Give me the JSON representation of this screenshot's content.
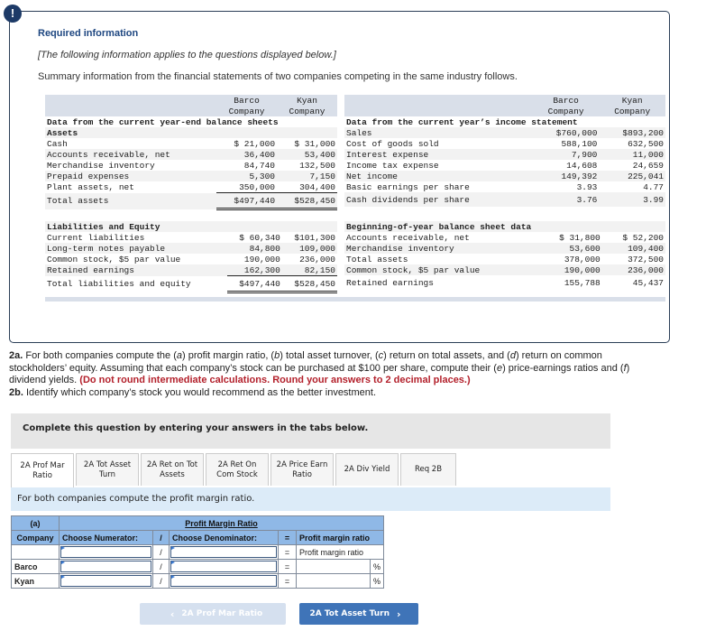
{
  "header": {
    "badge": "!",
    "title": "Required information",
    "italic_note": "[The following information applies to the questions displayed below.]",
    "summary": "Summary information from the financial statements of two companies competing in the same industry follows."
  },
  "columns": {
    "barco": "Barco",
    "barco2": "Company",
    "kyan": "Kyan",
    "kyan2": "Company"
  },
  "balance_sheet": {
    "title": "Data from the current year-end balance sheets",
    "assets_heading": "Assets",
    "rows": [
      {
        "label": "Cash",
        "barco": "$ 21,000",
        "kyan": "$ 31,000"
      },
      {
        "label": "Accounts receivable, net",
        "barco": "36,400",
        "kyan": "53,400"
      },
      {
        "label": "Merchandise inventory",
        "barco": "84,740",
        "kyan": "132,500"
      },
      {
        "label": "Prepaid expenses",
        "barco": "5,300",
        "kyan": "7,150"
      },
      {
        "label": "Plant assets, net",
        "barco": "350,000",
        "kyan": "304,400"
      },
      {
        "label": "Total assets",
        "barco": "$497,440",
        "kyan": "$528,450"
      }
    ],
    "liab_heading": "Liabilities and Equity",
    "liab_rows": [
      {
        "label": "Current liabilities",
        "barco": "$ 60,340",
        "kyan": "$101,300"
      },
      {
        "label": "Long-term notes payable",
        "barco": "84,800",
        "kyan": "109,000"
      },
      {
        "label": "Common stock, $5 par value",
        "barco": "190,000",
        "kyan": "236,000"
      },
      {
        "label": "Retained earnings",
        "barco": "162,300",
        "kyan": "82,150"
      },
      {
        "label": "Total liabilities and equity",
        "barco": "$497,440",
        "kyan": "$528,450"
      }
    ]
  },
  "income_statement": {
    "title": "Data from the current year’s income statement",
    "rows": [
      {
        "label": "Sales",
        "barco": "$760,000",
        "kyan": "$893,200"
      },
      {
        "label": "Cost of goods sold",
        "barco": "588,100",
        "kyan": "632,500"
      },
      {
        "label": "Interest expense",
        "barco": "7,900",
        "kyan": "11,000"
      },
      {
        "label": "Income tax expense",
        "barco": "14,608",
        "kyan": "24,659"
      },
      {
        "label": "Net income",
        "barco": "149,392",
        "kyan": "225,041"
      },
      {
        "label": "Basic earnings per share",
        "barco": "3.93",
        "kyan": "4.77"
      },
      {
        "label": "Cash dividends per share",
        "barco": "3.76",
        "kyan": "3.99"
      }
    ]
  },
  "beginning": {
    "title": "Beginning-of-year balance sheet data",
    "rows": [
      {
        "label": "Accounts receivable, net",
        "barco": "$ 31,800",
        "kyan": "$ 52,200"
      },
      {
        "label": "Merchandise inventory",
        "barco": "53,600",
        "kyan": "109,400"
      },
      {
        "label": "Total assets",
        "barco": "378,000",
        "kyan": "372,500"
      },
      {
        "label": "Common stock, $5 par value",
        "barco": "190,000",
        "kyan": "236,000"
      },
      {
        "label": "Retained earnings",
        "barco": "155,788",
        "kyan": "45,437"
      }
    ]
  },
  "question": {
    "p2a_label": "2a.",
    "p2a_text1": " For both companies compute the (",
    "a": "a",
    "t_a": ") profit margin ratio, (",
    "b": "b",
    "t_b": ") total asset turnover, (",
    "c": "c",
    "t_c": ") return on total assets, and (",
    "d": "d",
    "t_d": ") return on common stockholders’ equity. Assuming that each company’s stock can be purchased at $100 per share, compute their (",
    "e": "e",
    "t_e": ") price-earnings ratios and (",
    "f": "f",
    "t_f": ") dividend yields. ",
    "red": "(Do not round intermediate calculations. Round your answers to 2 decimal places.)",
    "p2b_label": "2b.",
    "p2b_text": " Identify which company’s stock you would recommend as the better investment."
  },
  "complete_bar": "Complete this question by entering your answers in the tabs below.",
  "tabs": [
    {
      "l1": "2A Prof Mar",
      "l2": "Ratio"
    },
    {
      "l1": "2A Tot Asset",
      "l2": "Turn"
    },
    {
      "l1": "2A Ret on Tot",
      "l2": "Assets"
    },
    {
      "l1": "2A Ret On",
      "l2": "Com Stock"
    },
    {
      "l1": "2A Price Earn",
      "l2": "Ratio"
    },
    {
      "l1": "2A Div Yield",
      "l2": ""
    },
    {
      "l1": "Req 2B",
      "l2": ""
    }
  ],
  "instruction": "For both companies compute the profit margin ratio.",
  "answer_table": {
    "part": "(a)",
    "title": "Profit Margin Ratio",
    "col_company": "Company",
    "col_numerator": "Choose Numerator:",
    "slash": "/",
    "col_denominator": "Choose Denominator:",
    "equals": "=",
    "col_result": "Profit margin ratio",
    "row0_result": "Profit margin ratio",
    "rows": [
      {
        "company": "Barco",
        "numerator": "",
        "denominator": "",
        "result": "",
        "unit": "%"
      },
      {
        "company": "Kyan",
        "numerator": "",
        "denominator": "",
        "result": "",
        "unit": "%"
      }
    ]
  },
  "nav": {
    "prev_label": "2A Prof Mar Ratio",
    "next_label": "2A Tot Asset Turn"
  }
}
